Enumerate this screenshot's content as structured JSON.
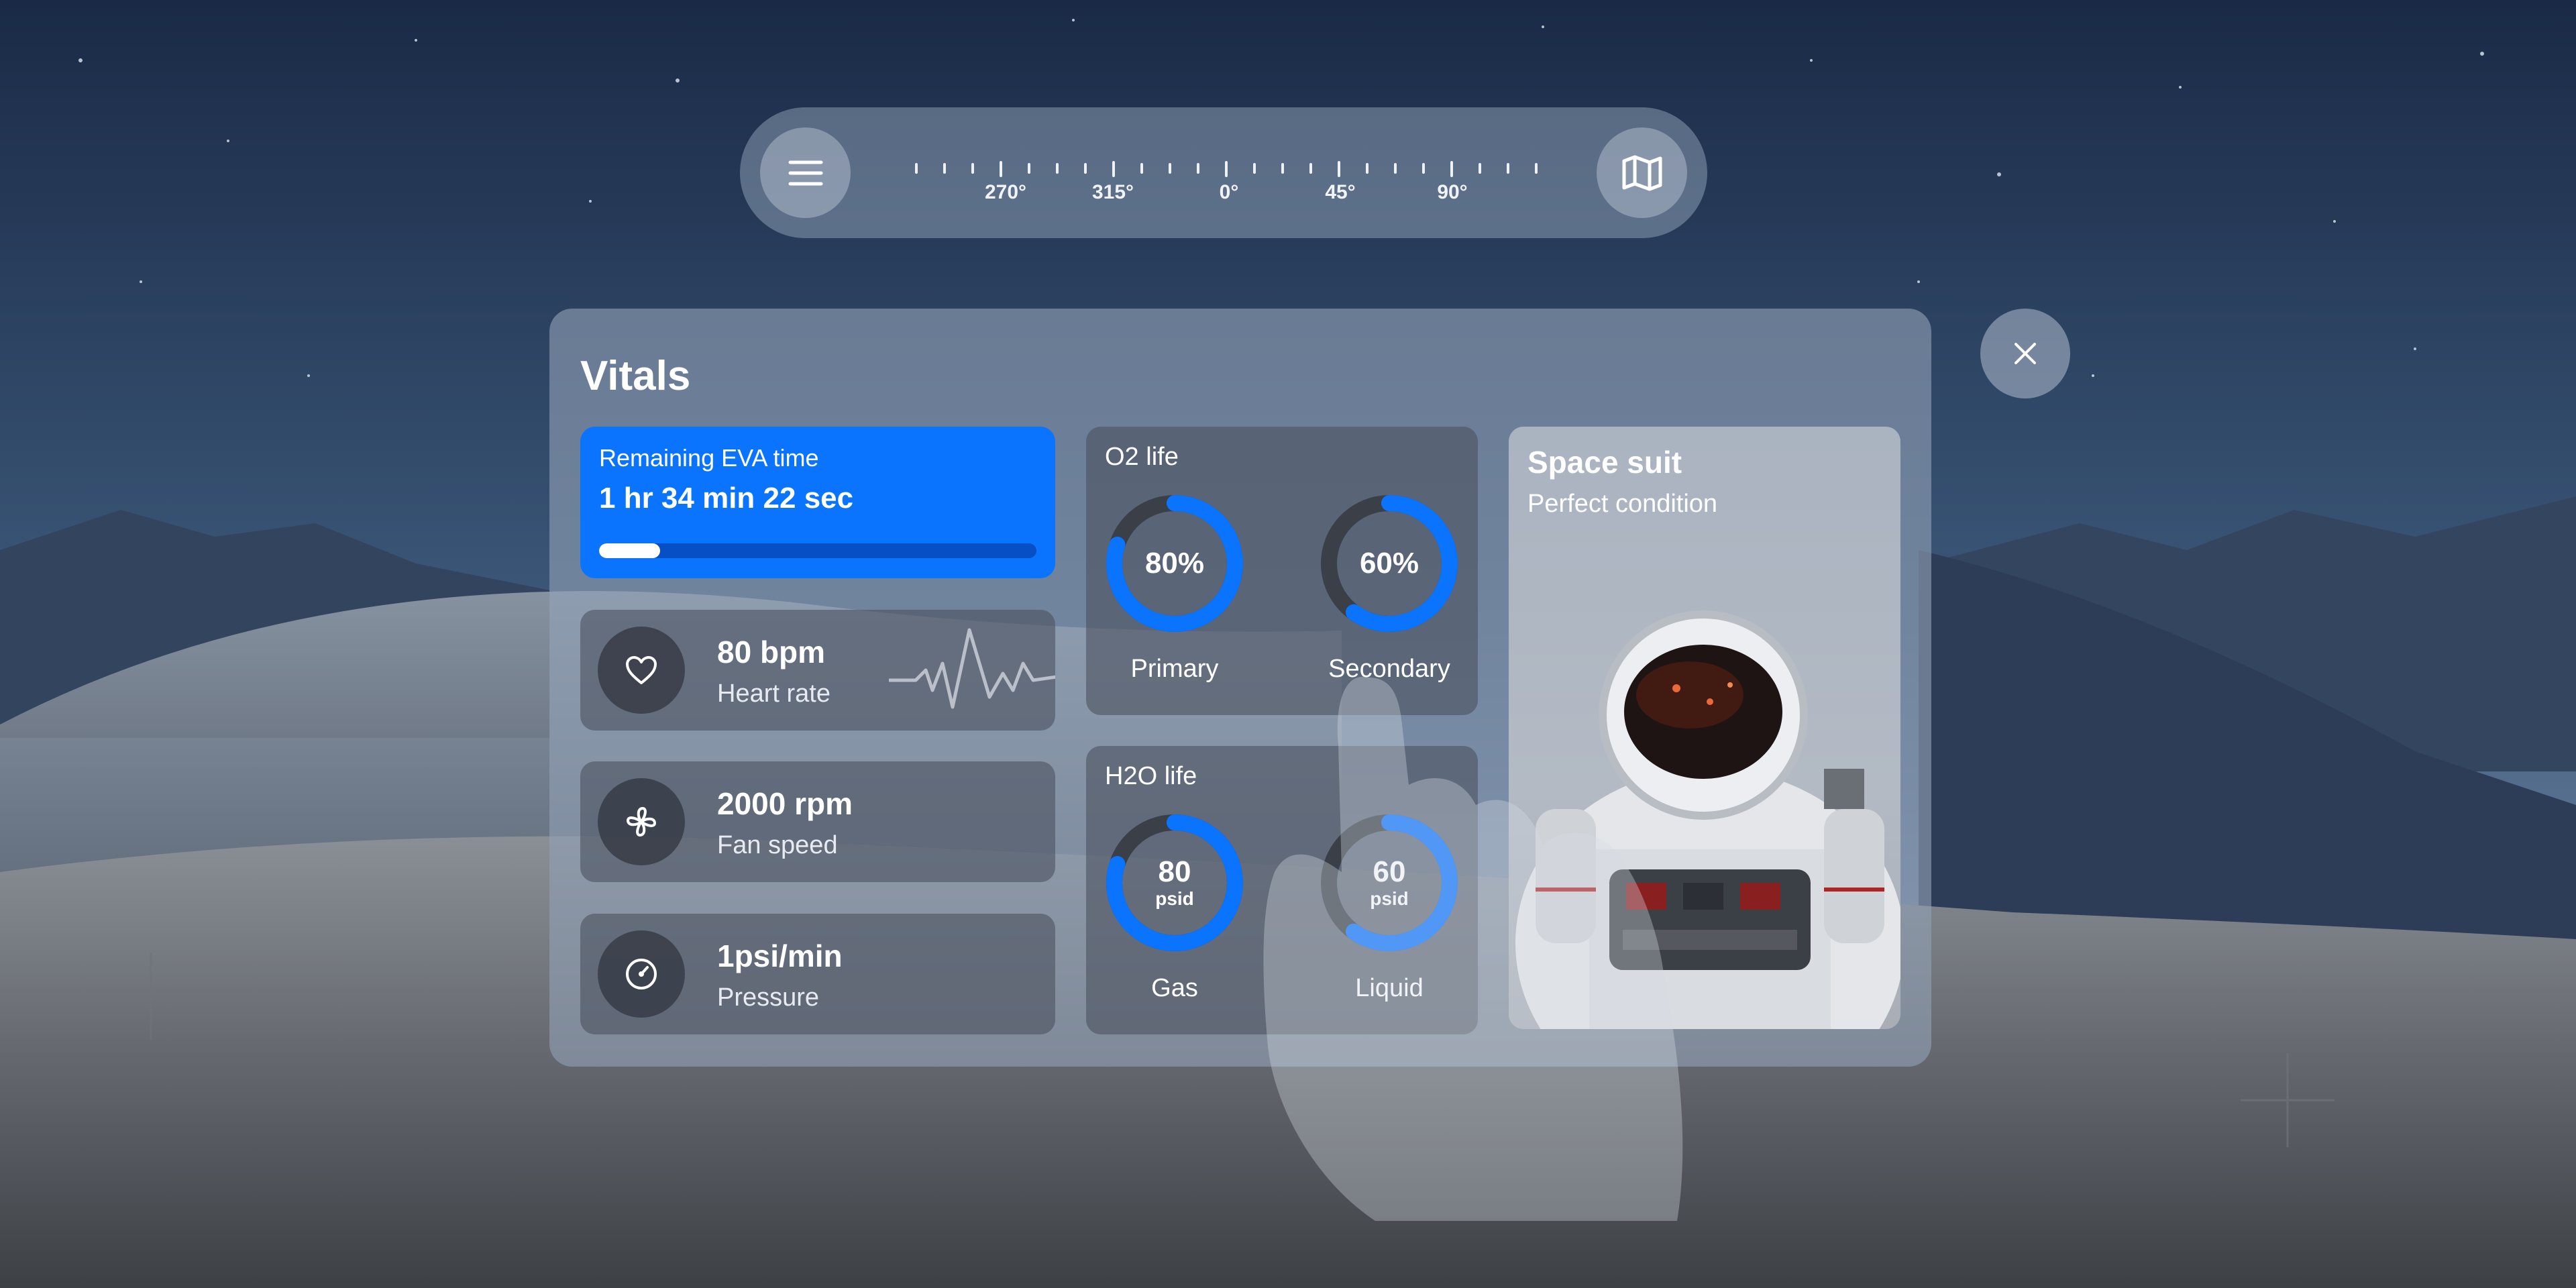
{
  "compass": {
    "labels": [
      "270°",
      "315°",
      "0°",
      "45°",
      "90°"
    ],
    "menu_icon": "hamburger-menu-icon",
    "map_icon": "map-icon"
  },
  "close_icon": "close-icon",
  "vitals": {
    "title": "Vitals",
    "eva": {
      "label": "Remaining EVA time",
      "time": "1 hr 34 min 22 sec",
      "progress": 0.14
    },
    "stats": [
      {
        "value": "80 bpm",
        "label": "Heart rate",
        "icon": "heart-icon"
      },
      {
        "value": "2000 rpm",
        "label": "Fan speed",
        "icon": "fan-icon"
      },
      {
        "value": "1psi/min",
        "label": "Pressure",
        "icon": "gauge-icon"
      }
    ],
    "o2": {
      "title": "O2 life",
      "gauges": [
        {
          "text": "80%",
          "caption": "Primary",
          "level": 0.8
        },
        {
          "text": "60%",
          "caption": "Secondary",
          "level": 0.6
        }
      ]
    },
    "h2o": {
      "title": "H2O life",
      "gauges": [
        {
          "number": "80",
          "unit": "psid",
          "caption": "Gas",
          "level": 0.8
        },
        {
          "number": "60",
          "unit": "psid",
          "caption": "Liquid",
          "level": 0.6
        }
      ]
    },
    "suit": {
      "title": "Space suit",
      "status": "Perfect condition"
    }
  },
  "colors": {
    "accent": "#0a74ff",
    "gauge_track": "#3a3f48"
  }
}
